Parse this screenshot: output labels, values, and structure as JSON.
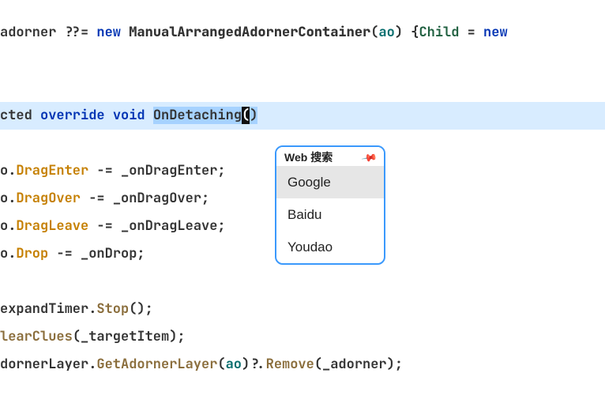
{
  "code": {
    "line1": {
      "pre": "adorner ??= ",
      "kw_new": "new",
      "space1": " ",
      "type": "ManualArrangedAdornerContainer",
      "open": "(",
      "param": "ao",
      "close": ") {",
      "member": "Child",
      "eq": " = ",
      "kw_new2": "new",
      "tail": " "
    },
    "line_method": {
      "pre": "cted ",
      "kw_override": "override",
      "space1": " ",
      "kw_void": "void",
      "space2": " ",
      "name": "OnDetaching",
      "paren_open": "(",
      "paren_close": ")"
    },
    "line_dragenter": {
      "prefix": "o.",
      "prop": "DragEnter",
      "op": " -= _onDragEnter;"
    },
    "line_dragover": {
      "prefix": "o.",
      "prop": "DragOver",
      "op": " -= _onDragOver;"
    },
    "line_dragleave": {
      "prefix": "o.",
      "prop": "DragLeave",
      "op": " -= _onDragLeave;"
    },
    "line_drop": {
      "prefix": "o.",
      "prop": "Drop",
      "op": " -= _onDrop;"
    },
    "line_stop": {
      "obj": "expandTimer.",
      "method": "Stop",
      "tail": "();"
    },
    "line_clear": {
      "method": "learClues",
      "tail": "(_targetItem);"
    },
    "line_adorner": {
      "obj": "dornerLayer.",
      "method1": "GetAdornerLayer",
      "open": "(",
      "param": "ao",
      "close": ")?.",
      "method2": "Remove",
      "tail": "(_adorner);"
    }
  },
  "menu": {
    "title": "Web 搜索",
    "pin_tooltip": "Pin",
    "items": [
      "Google",
      "Baidu",
      "Youdao"
    ],
    "hovered_index": 0
  },
  "colors": {
    "keyword_blue": "#0033b3",
    "method_green": "#206040",
    "identifier_brown": "#8a6d3b",
    "param_teal": "#056d6d",
    "selection_bg": "#a6d2ff",
    "line_highlight": "#d8ecff",
    "menu_border": "#3b99fc"
  }
}
